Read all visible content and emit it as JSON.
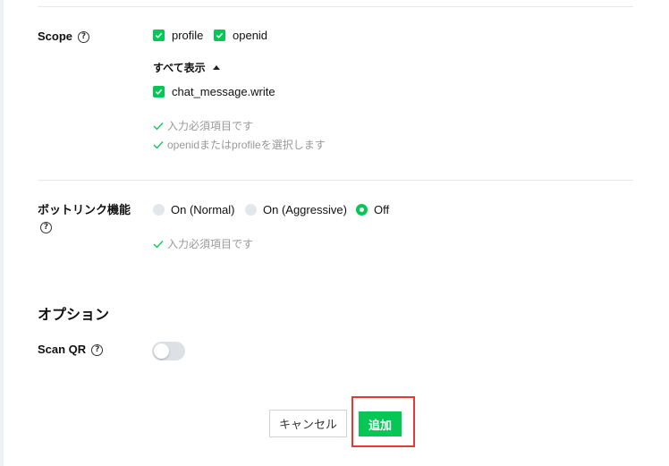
{
  "scope": {
    "label": "Scope",
    "options": [
      {
        "label": "profile",
        "checked": true
      },
      {
        "label": "openid",
        "checked": true
      }
    ],
    "show_all": "すべて表示",
    "extra_options": [
      {
        "label": "chat_message.write",
        "checked": true
      }
    ],
    "hints": [
      "入力必須項目です",
      "openidまたはprofileを選択します"
    ]
  },
  "bot_link": {
    "label": "ボットリンク機能",
    "options": [
      {
        "label": "On (Normal)",
        "selected": false
      },
      {
        "label": "On (Aggressive)",
        "selected": false
      },
      {
        "label": "Off",
        "selected": true
      }
    ],
    "hint": "入力必須項目です"
  },
  "options_section": {
    "title": "オプション",
    "scan_qr": {
      "label": "Scan QR",
      "enabled": false
    }
  },
  "actions": {
    "cancel_label": "キャンセル",
    "add_label": "追加"
  },
  "colors": {
    "accent": "#06c755",
    "highlight": "#e53935",
    "hint_text": "#999999"
  }
}
